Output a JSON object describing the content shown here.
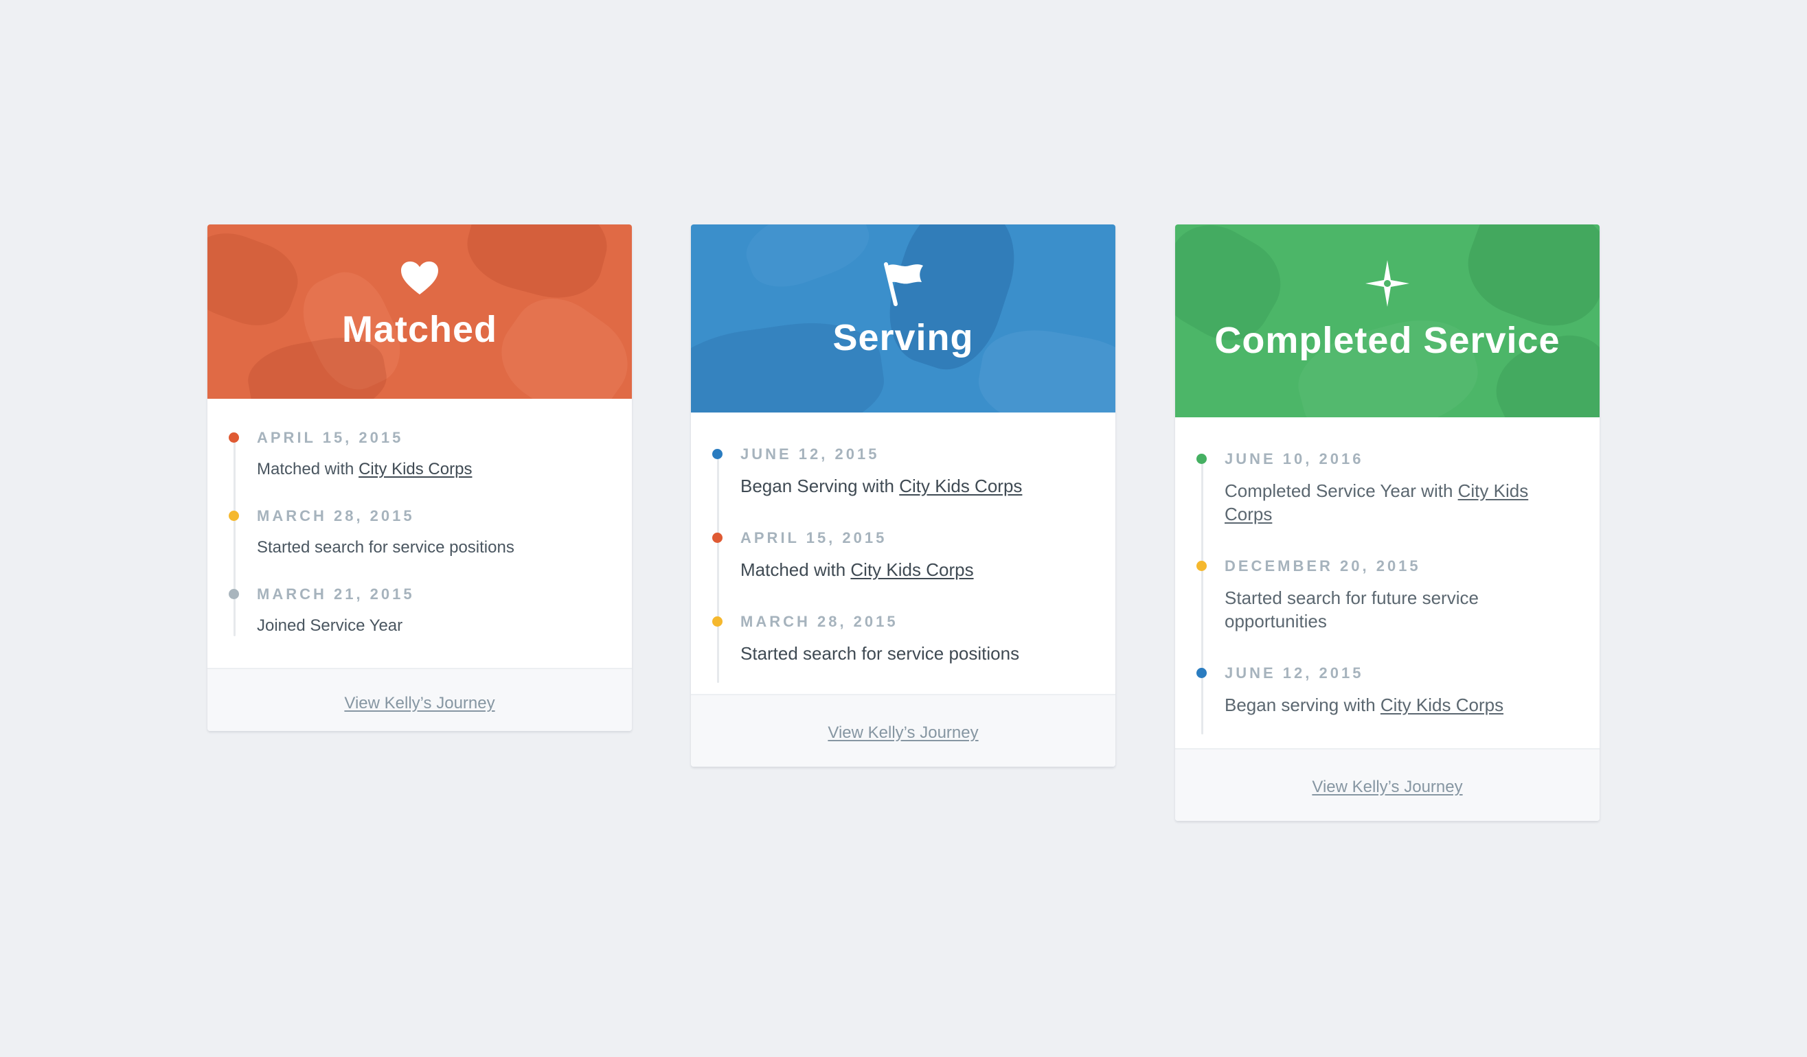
{
  "cards": [
    {
      "status_icon": "heart-icon",
      "title": "Matched",
      "color": "#e06a45",
      "entries": [
        {
          "date": "APRIL 15, 2015",
          "text": "Matched with ",
          "link": "City Kids Corps",
          "dot_color": "#df5a33"
        },
        {
          "date": "MARCH 28, 2015",
          "text": "Started search for service positions",
          "link": "",
          "dot_color": "#f5b82e"
        },
        {
          "date": "MARCH 21, 2015",
          "text": "Joined Service Year",
          "link": "",
          "dot_color": "#a9b5bd"
        }
      ],
      "footer_link": "View Kelly’s Journey"
    },
    {
      "status_icon": "flag-icon",
      "title": "Serving",
      "color": "#3b8fcb",
      "entries": [
        {
          "date": "JUNE 12, 2015",
          "text": "Began Serving with ",
          "link": "City Kids Corps",
          "dot_color": "#2a7cc0"
        },
        {
          "date": "APRIL 15, 2015",
          "text": "Matched with ",
          "link": "City Kids Corps",
          "dot_color": "#df5a33"
        },
        {
          "date": "MARCH 28, 2015",
          "text": "Started search for service positions",
          "link": "",
          "dot_color": "#f5b82e"
        }
      ],
      "footer_link": "View Kelly’s Journey"
    },
    {
      "status_icon": "compass-star-icon",
      "title": "Completed Service",
      "color": "#4cb668",
      "entries": [
        {
          "date": "JUNE 10, 2016",
          "text": "Completed Service Year with ",
          "link": "City Kids Corps",
          "dot_color": "#45b062"
        },
        {
          "date": "DECEMBER 20, 2015",
          "text": "Started search for future service opportunities",
          "link": "",
          "dot_color": "#f5b82e"
        },
        {
          "date": "JUNE 12, 2015",
          "text": "Began serving with ",
          "link": "City Kids Corps",
          "dot_color": "#2a7cc0"
        }
      ],
      "footer_link": "View Kelly’s Journey"
    }
  ]
}
